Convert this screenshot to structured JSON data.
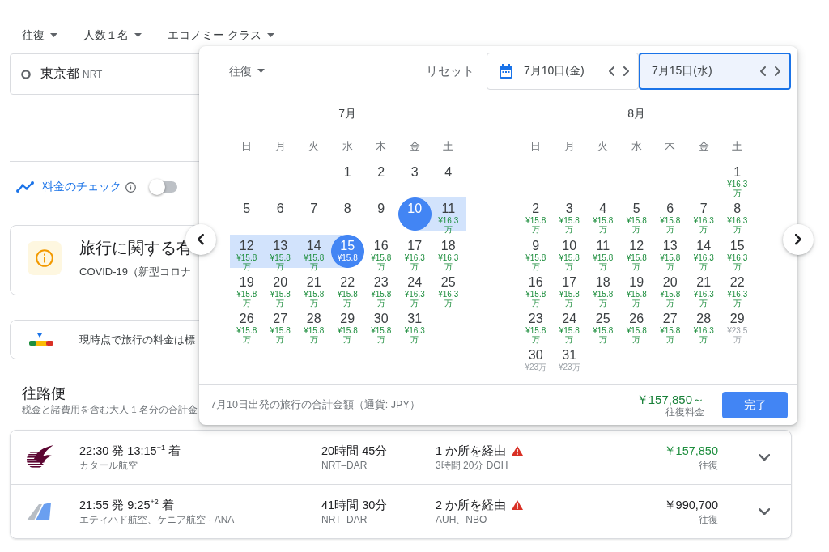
{
  "search_options": [
    {
      "label": "往復"
    },
    {
      "label": "人数１名"
    },
    {
      "label": "エコノミー クラス"
    }
  ],
  "origin": {
    "city": "東京都",
    "code": "NRT"
  },
  "price_tracking": {
    "label": "料金のチェック",
    "on": false
  },
  "advisory": {
    "title": "旅行に関する有",
    "text": "COVID-19（新型コロナ"
  },
  "price_insight": {
    "text": "現時点で旅行の料金は標"
  },
  "results": {
    "title": "往路便",
    "subtitle": "税金と諸費用を含む大人 1 名分の合計金"
  },
  "flights": [
    {
      "kind": "emblem",
      "times": "22:30 発 13:15$^{+1}$ 着",
      "airline": "カタール航空",
      "duration": "20時間 45分",
      "route": "NRT–DAR",
      "stops": "1 か所を経由",
      "warning": true,
      "layover": "3時間 20分 DOH",
      "price": "￥157,850",
      "price_note": "往復",
      "lowest": true
    },
    {
      "kind": "fin",
      "times": "21:55 発 9:25$^{+2}$ 着",
      "airline": "エティハド航空、ケニア航空 · ANA",
      "duration": "41時間 30分",
      "route": "NRT–DAR",
      "stops": "2 か所を経由",
      "warning": true,
      "layover": "AUH、NBO",
      "price": "￥990,700",
      "price_note": "往復",
      "lowest": false
    }
  ],
  "date_picker": {
    "trip_type": "往復",
    "reset": "リセット",
    "dates": [
      {
        "kind": "start",
        "label": "7月10日(金)",
        "selected": false
      },
      {
        "kind": "end",
        "label": "7月15日(水)",
        "selected": true
      }
    ],
    "months": [
      {
        "title": "7月",
        "weekdays": [
          "日",
          "月",
          "火",
          "水",
          "木",
          "金",
          "土"
        ],
        "days": [
          {
            "kind": "blank"
          },
          {
            "kind": "blank"
          },
          {
            "kind": "blank"
          },
          {
            "kind": "day",
            "day": "1",
            "selected": false,
            "in_range": false
          },
          {
            "kind": "day",
            "day": "2",
            "selected": false,
            "in_range": false
          },
          {
            "kind": "day",
            "day": "3",
            "selected": false,
            "in_range": false
          },
          {
            "kind": "day",
            "day": "4",
            "selected": false,
            "in_range": false
          },
          {
            "kind": "day",
            "day": "5",
            "selected": false,
            "in_range": false
          },
          {
            "kind": "day",
            "day": "6",
            "selected": false,
            "in_range": false
          },
          {
            "kind": "day",
            "day": "7",
            "selected": false,
            "in_range": false
          },
          {
            "kind": "day",
            "day": "8",
            "selected": false,
            "in_range": false
          },
          {
            "kind": "day",
            "day": "9",
            "selected": false,
            "in_range": false
          },
          {
            "kind": "day",
            "day": "10",
            "selected": true,
            "in_range": false
          },
          {
            "kind": "day",
            "day": "11",
            "selected": false,
            "in_range": true,
            "price": "¥16.3万",
            "cheap": true
          },
          {
            "kind": "day",
            "day": "12",
            "selected": false,
            "in_range": true,
            "price": "¥15.8万",
            "cheap": true
          },
          {
            "kind": "day",
            "day": "13",
            "selected": false,
            "in_range": true,
            "price": "¥15.8万",
            "cheap": true
          },
          {
            "kind": "day",
            "day": "14",
            "selected": false,
            "in_range": true,
            "price": "¥15.8万",
            "cheap": true
          },
          {
            "kind": "day",
            "day": "15",
            "selected": true,
            "in_range": false,
            "price": "¥15.8",
            "cheap": true
          },
          {
            "kind": "day",
            "day": "16",
            "selected": false,
            "in_range": false,
            "price": "¥15.8万",
            "cheap": true
          },
          {
            "kind": "day",
            "day": "17",
            "selected": false,
            "in_range": false,
            "price": "¥16.3万",
            "cheap": true
          },
          {
            "kind": "day",
            "day": "18",
            "selected": false,
            "in_range": false,
            "price": "¥16.3万",
            "cheap": true
          },
          {
            "kind": "day",
            "day": "19",
            "selected": false,
            "in_range": false,
            "price": "¥15.8万",
            "cheap": true
          },
          {
            "kind": "day",
            "day": "20",
            "selected": false,
            "in_range": false,
            "price": "¥15.8万",
            "cheap": true
          },
          {
            "kind": "day",
            "day": "21",
            "selected": false,
            "in_range": false,
            "price": "¥15.8万",
            "cheap": true
          },
          {
            "kind": "day",
            "day": "22",
            "selected": false,
            "in_range": false,
            "price": "¥15.8万",
            "cheap": true
          },
          {
            "kind": "day",
            "day": "23",
            "selected": false,
            "in_range": false,
            "price": "¥15.8万",
            "cheap": true
          },
          {
            "kind": "day",
            "day": "24",
            "selected": false,
            "in_range": false,
            "price": "¥16.3万",
            "cheap": true
          },
          {
            "kind": "day",
            "day": "25",
            "selected": false,
            "in_range": false,
            "price": "¥16.3万",
            "cheap": true
          },
          {
            "kind": "day",
            "day": "26",
            "selected": false,
            "in_range": false,
            "price": "¥15.8万",
            "cheap": true
          },
          {
            "kind": "day",
            "day": "27",
            "selected": false,
            "in_range": false,
            "price": "¥15.8万",
            "cheap": true
          },
          {
            "kind": "day",
            "day": "28",
            "selected": false,
            "in_range": false,
            "price": "¥15.8万",
            "cheap": true
          },
          {
            "kind": "day",
            "day": "29",
            "selected": false,
            "in_range": false,
            "price": "¥15.8万",
            "cheap": true
          },
          {
            "kind": "day",
            "day": "30",
            "selected": false,
            "in_range": false,
            "price": "¥15.8万",
            "cheap": true
          },
          {
            "kind": "day",
            "day": "31",
            "selected": false,
            "in_range": false,
            "price": "¥16.3万",
            "cheap": true
          }
        ]
      },
      {
        "title": "8月",
        "weekdays": [
          "日",
          "月",
          "火",
          "水",
          "木",
          "金",
          "土"
        ],
        "days": [
          {
            "kind": "blank"
          },
          {
            "kind": "blank"
          },
          {
            "kind": "blank"
          },
          {
            "kind": "blank"
          },
          {
            "kind": "blank"
          },
          {
            "kind": "blank"
          },
          {
            "kind": "day",
            "day": "1",
            "selected": false,
            "in_range": false,
            "price": "¥16.3万",
            "cheap": true
          },
          {
            "kind": "day",
            "day": "2",
            "selected": false,
            "in_range": false,
            "price": "¥15.8万",
            "cheap": true
          },
          {
            "kind": "day",
            "day": "3",
            "selected": false,
            "in_range": false,
            "price": "¥15.8万",
            "cheap": true
          },
          {
            "kind": "day",
            "day": "4",
            "selected": false,
            "in_range": false,
            "price": "¥15.8万",
            "cheap": true
          },
          {
            "kind": "day",
            "day": "5",
            "selected": false,
            "in_range": false,
            "price": "¥15.8万",
            "cheap": true
          },
          {
            "kind": "day",
            "day": "6",
            "selected": false,
            "in_range": false,
            "price": "¥15.8万",
            "cheap": true
          },
          {
            "kind": "day",
            "day": "7",
            "selected": false,
            "in_range": false,
            "price": "¥16.3万",
            "cheap": true
          },
          {
            "kind": "day",
            "day": "8",
            "selected": false,
            "in_range": false,
            "price": "¥16.3万",
            "cheap": true
          },
          {
            "kind": "day",
            "day": "9",
            "selected": false,
            "in_range": false,
            "price": "¥15.8万",
            "cheap": true
          },
          {
            "kind": "day",
            "day": "10",
            "selected": false,
            "in_range": false,
            "price": "¥15.8万",
            "cheap": true
          },
          {
            "kind": "day",
            "day": "11",
            "selected": false,
            "in_range": false,
            "price": "¥15.8万",
            "cheap": true
          },
          {
            "kind": "day",
            "day": "12",
            "selected": false,
            "in_range": false,
            "price": "¥15.8万",
            "cheap": true
          },
          {
            "kind": "day",
            "day": "13",
            "selected": false,
            "in_range": false,
            "price": "¥15.8万",
            "cheap": true
          },
          {
            "kind": "day",
            "day": "14",
            "selected": false,
            "in_range": false,
            "price": "¥16.3万",
            "cheap": true
          },
          {
            "kind": "day",
            "day": "15",
            "selected": false,
            "in_range": false,
            "price": "¥16.3万",
            "cheap": true
          },
          {
            "kind": "day",
            "day": "16",
            "selected": false,
            "in_range": false,
            "price": "¥15.8万",
            "cheap": true
          },
          {
            "kind": "day",
            "day": "17",
            "selected": false,
            "in_range": false,
            "price": "¥15.8万",
            "cheap": true
          },
          {
            "kind": "day",
            "day": "18",
            "selected": false,
            "in_range": false,
            "price": "¥15.8万",
            "cheap": true
          },
          {
            "kind": "day",
            "day": "19",
            "selected": false,
            "in_range": false,
            "price": "¥15.8万",
            "cheap": true
          },
          {
            "kind": "day",
            "day": "20",
            "selected": false,
            "in_range": false,
            "price": "¥15.8万",
            "cheap": true
          },
          {
            "kind": "day",
            "day": "21",
            "selected": false,
            "in_range": false,
            "price": "¥16.3万",
            "cheap": true
          },
          {
            "kind": "day",
            "day": "22",
            "selected": false,
            "in_range": false,
            "price": "¥16.3万",
            "cheap": true
          },
          {
            "kind": "day",
            "day": "23",
            "selected": false,
            "in_range": false,
            "price": "¥15.8万",
            "cheap": true
          },
          {
            "kind": "day",
            "day": "24",
            "selected": false,
            "in_range": false,
            "price": "¥15.8万",
            "cheap": true
          },
          {
            "kind": "day",
            "day": "25",
            "selected": false,
            "in_range": false,
            "price": "¥15.8万",
            "cheap": true
          },
          {
            "kind": "day",
            "day": "26",
            "selected": false,
            "in_range": false,
            "price": "¥15.8万",
            "cheap": true
          },
          {
            "kind": "day",
            "day": "27",
            "selected": false,
            "in_range": false,
            "price": "¥15.8万",
            "cheap": true
          },
          {
            "kind": "day",
            "day": "28",
            "selected": false,
            "in_range": false,
            "price": "¥16.3万",
            "cheap": true
          },
          {
            "kind": "day",
            "day": "29",
            "selected": false,
            "in_range": false,
            "price": "¥23.5万",
            "cheap": false
          },
          {
            "kind": "day",
            "day": "30",
            "selected": false,
            "in_range": false,
            "price": "¥23万",
            "cheap": false
          },
          {
            "kind": "day",
            "day": "31",
            "selected": false,
            "in_range": false,
            "price": "¥23万",
            "cheap": false
          }
        ]
      }
    ],
    "summary": "7月10日出発の旅行の合計金額（通貨: JPY）",
    "total": "￥157,850～",
    "total_note": "往復料金",
    "done": "完了"
  }
}
